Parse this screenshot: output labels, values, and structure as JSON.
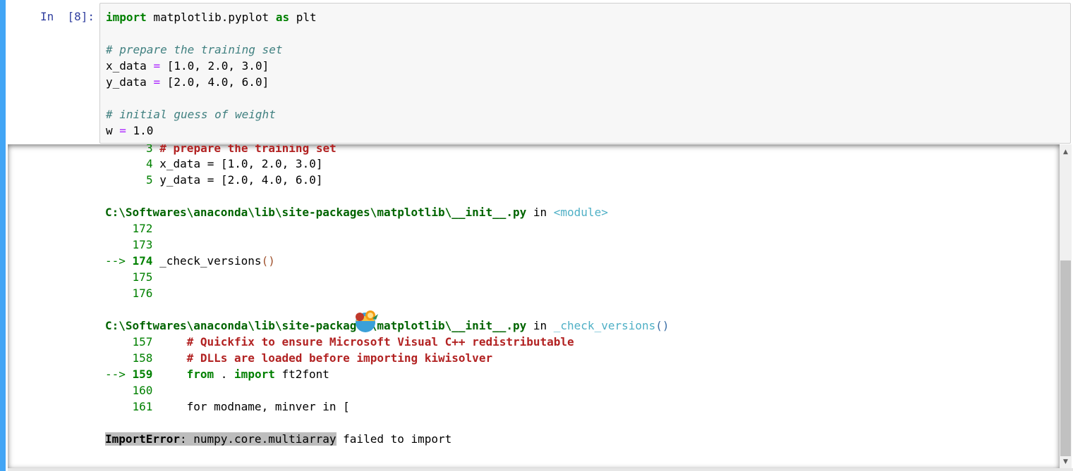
{
  "cell": {
    "prompt": "In  [8]:"
  },
  "input_code": {
    "l1_kw1": "import",
    "l1_mod": " matplotlib.pyplot ",
    "l1_kw2": "as",
    "l1_alias": " plt",
    "l3_comment": "# prepare the training set",
    "l4_name": "x_data ",
    "l4_eq": "=",
    "l4_val": " [1.0, 2.0, 3.0]",
    "l5_name": "y_data ",
    "l5_eq": "=",
    "l5_val": " [2.0, 4.0, 6.0]",
    "l7_comment": "# initial guess of weight",
    "l8_name": "w ",
    "l8_eq": "=",
    "l8_val": " 1.0"
  },
  "traceback": {
    "cut_line_no": "3",
    "cut_line_text": " # prepare the training set",
    "line4_no": "4",
    "line4_text": " x_data = [1.0, 2.0, 3.0]",
    "line5_no": "5",
    "line5_text": " y_data = [2.0, 4.0, 6.0]",
    "frame1_path": "C:\\Softwares\\anaconda\\lib\\site-packages\\matplotlib\\__init__.py",
    "frame1_in": " in ",
    "frame1_func": "<module>",
    "f1_l172": "    172",
    "f1_l173": "    173",
    "f1_arrow": "--> ",
    "f1_l174": "174",
    "f1_l174_code": " _check_versions",
    "f1_l174_paren": "()",
    "f1_l175": "    175",
    "f1_l176": "    176",
    "frame2_path": "C:\\Softwares\\anaconda\\lib\\site-packages\\matplotlib\\__init__.py",
    "frame2_in": " in ",
    "frame2_func": "_check_versions",
    "frame2_paren": "()",
    "f2_l157": "    157",
    "f2_l157_code": "     # Quickfix to ensure Microsoft Visual C++ redistributable",
    "f2_l158": "    158",
    "f2_l158_code": "     # DLLs are loaded before importing kiwisolver",
    "f2_arrow": "--> ",
    "f2_l159": "159",
    "f2_l159_kw1": "from",
    "f2_l159_dot": " . ",
    "f2_l159_kw2": "import",
    "f2_l159_rest": " ft2font",
    "f2_l160": "    160",
    "f2_l161": "    161",
    "f2_l161_code": "     for modname, minver in [",
    "error_name": "ImportError",
    "error_colon": ": numpy.core.multiarray",
    "error_rest": " failed to import"
  },
  "scrollbar": {
    "up_arrow": "▲",
    "down_arrow": "▼"
  },
  "colors": {
    "selection_bar": "#42a5f5",
    "prompt": "#303f9f",
    "keyword": "#008000",
    "comment": "#408080",
    "operator": "#aa22ff",
    "traceback_comment": "#b22222",
    "error_highlight": "#bdbdbd"
  }
}
